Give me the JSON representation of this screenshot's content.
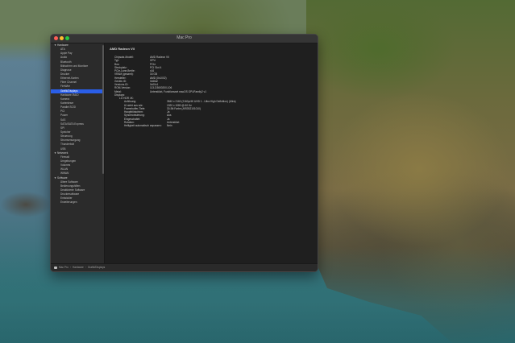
{
  "window": {
    "title": "Mac Pro"
  },
  "sidebar": {
    "items": [
      {
        "label": "Hardware",
        "type": "section"
      },
      {
        "label": "ATA",
        "type": "item"
      },
      {
        "label": "Apple Pay",
        "type": "item"
      },
      {
        "label": "Audio",
        "type": "item"
      },
      {
        "label": "Bluetooth",
        "type": "item"
      },
      {
        "label": "Bildschirm und Monitore",
        "type": "item"
      },
      {
        "label": "Diagnose",
        "type": "item"
      },
      {
        "label": "Drucker",
        "type": "item"
      },
      {
        "label": "Ethernet-Karten",
        "type": "item"
      },
      {
        "label": "Fibre Channel",
        "type": "item"
      },
      {
        "label": "FireWire",
        "type": "item"
      },
      {
        "label": "Grafik/Displays",
        "type": "item",
        "selected": true
      },
      {
        "label": "Hardware-RAID",
        "type": "item"
      },
      {
        "label": "Kamera",
        "type": "item"
      },
      {
        "label": "Kartenleser",
        "type": "item"
      },
      {
        "label": "Parallel SCSI",
        "type": "item"
      },
      {
        "label": "PCI",
        "type": "item"
      },
      {
        "label": "Power",
        "type": "item"
      },
      {
        "label": "SAS",
        "type": "item"
      },
      {
        "label": "SATA/SATA Express",
        "type": "item"
      },
      {
        "label": "SPI",
        "type": "item"
      },
      {
        "label": "Speicher",
        "type": "item"
      },
      {
        "label": "Steuerung",
        "type": "item"
      },
      {
        "label": "Stromversorgung",
        "type": "item"
      },
      {
        "label": "Thunderbolt",
        "type": "item"
      },
      {
        "label": "USB",
        "type": "item"
      },
      {
        "label": "Netzwerk",
        "type": "section"
      },
      {
        "label": "Firewall",
        "type": "item"
      },
      {
        "label": "Umgebungen",
        "type": "item"
      },
      {
        "label": "Volumes",
        "type": "item"
      },
      {
        "label": "WLAN",
        "type": "item"
      },
      {
        "label": "WWAN",
        "type": "item"
      },
      {
        "label": "Software",
        "type": "section"
      },
      {
        "label": "Ältere Software",
        "type": "item"
      },
      {
        "label": "Bedienungshilfen",
        "type": "item"
      },
      {
        "label": "Deaktivierte Software",
        "type": "item"
      },
      {
        "label": "Druckersoftware",
        "type": "item"
      },
      {
        "label": "Entwickler",
        "type": "item"
      },
      {
        "label": "Erweiterungen",
        "type": "item"
      }
    ]
  },
  "content": {
    "title": "AMD Radeon VII",
    "rows": [
      {
        "key": "Chipsatz-Modell:",
        "value": "AMD Radeon VII"
      },
      {
        "key": "Typ:",
        "value": "GPU"
      },
      {
        "key": "Bus:",
        "value": "PCIe"
      },
      {
        "key": "Steckplatz:",
        "value": "PCI Slot 4"
      },
      {
        "key": "PCIe-Lane-Breite:",
        "value": "x16"
      },
      {
        "key": "VRAM (gesamt):",
        "value": "16 GB"
      },
      {
        "key": "Hersteller:",
        "value": "AMD (0x1002)"
      },
      {
        "key": "Geräte-ID:",
        "value": "0x66af"
      },
      {
        "key": "Versions-ID:",
        "value": "0x00c1"
      },
      {
        "key": "ROM-Version:",
        "value": "113-D3600200-106"
      },
      {
        "key": "Metal:",
        "value": "Unterstützt, Funktionsset macOS GPUFamily2 v1"
      },
      {
        "key": "Displays:",
        "value": ""
      }
    ],
    "display_name": "LG HDR 4K:",
    "display_rows": [
      {
        "key": "Auflösung:",
        "value": "3840 x 2160 (2160p/4K UHD 1 - Ultra High Definition) (Ultra)"
      },
      {
        "key": "UI sieht aus wie:",
        "value": "1920 x 1080 @ 60 Hz"
      },
      {
        "key": "Framebuffer-Tiefe:",
        "value": "30-Bit Farbe (ARGB2101010)"
      },
      {
        "key": "Hauptbildschirm:",
        "value": "Ja"
      },
      {
        "key": "Synchronisierung:",
        "value": "Aus"
      },
      {
        "key": "Eingeschaltet:",
        "value": "Ja"
      },
      {
        "key": "Rotation:",
        "value": "Unterstützt"
      },
      {
        "key": "Helligkeit automatisch anpassen:",
        "value": "Nein"
      }
    ]
  },
  "statusbar": {
    "crumbs": [
      "Mac Pro",
      "Hardware",
      "Grafik/Displays"
    ]
  }
}
